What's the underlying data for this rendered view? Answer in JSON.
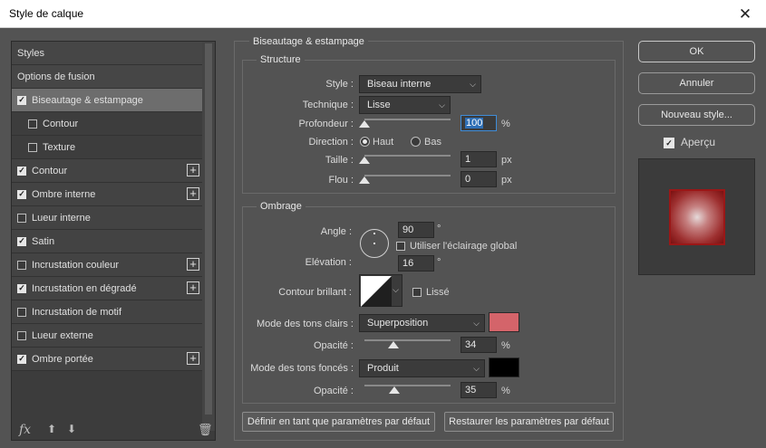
{
  "window": {
    "title": "Style de calque",
    "close_glyph": "✕"
  },
  "styles_list": [
    {
      "label": "Styles",
      "checkbox": false,
      "checked": false,
      "plus": false,
      "sub": false,
      "selected": false
    },
    {
      "label": "Options de fusion",
      "checkbox": false,
      "checked": false,
      "plus": false,
      "sub": false,
      "selected": false
    },
    {
      "label": "Biseautage & estampage",
      "checkbox": true,
      "checked": true,
      "plus": false,
      "sub": false,
      "selected": true
    },
    {
      "label": "Contour",
      "checkbox": true,
      "checked": false,
      "plus": false,
      "sub": true,
      "selected": false
    },
    {
      "label": "Texture",
      "checkbox": true,
      "checked": false,
      "plus": false,
      "sub": true,
      "selected": false
    },
    {
      "label": "Contour",
      "checkbox": true,
      "checked": true,
      "plus": true,
      "sub": false,
      "selected": false
    },
    {
      "label": "Ombre interne",
      "checkbox": true,
      "checked": true,
      "plus": true,
      "sub": false,
      "selected": false
    },
    {
      "label": "Lueur interne",
      "checkbox": true,
      "checked": false,
      "plus": false,
      "sub": false,
      "selected": false
    },
    {
      "label": "Satin",
      "checkbox": true,
      "checked": true,
      "plus": false,
      "sub": false,
      "selected": false
    },
    {
      "label": "Incrustation couleur",
      "checkbox": true,
      "checked": false,
      "plus": true,
      "sub": false,
      "selected": false
    },
    {
      "label": "Incrustation en dégradé",
      "checkbox": true,
      "checked": true,
      "plus": true,
      "sub": false,
      "selected": false
    },
    {
      "label": "Incrustation de motif",
      "checkbox": true,
      "checked": false,
      "plus": false,
      "sub": false,
      "selected": false
    },
    {
      "label": "Lueur externe",
      "checkbox": true,
      "checked": false,
      "plus": false,
      "sub": false,
      "selected": false
    },
    {
      "label": "Ombre portée",
      "checkbox": true,
      "checked": true,
      "plus": true,
      "sub": false,
      "selected": false
    }
  ],
  "fxbar": {
    "fx": "fx",
    "fx_dot": "⌄",
    "up": "⬆",
    "down": "⬇",
    "trash": "🗑"
  },
  "bevel": {
    "section_title": "Biseautage & estampage",
    "structure": {
      "title": "Structure",
      "style_label": "Style :",
      "style_value": "Biseau interne",
      "technique_label": "Technique :",
      "technique_value": "Lisse",
      "depth_label": "Profondeur :",
      "depth_value": "100",
      "depth_unit": "%",
      "depth_pct": 0,
      "direction_label": "Direction :",
      "dir_up": "Haut",
      "dir_down": "Bas",
      "direction_selected": "up",
      "size_label": "Taille :",
      "size_value": "1",
      "size_unit": "px",
      "size_pct": 0,
      "soften_label": "Flou :",
      "soften_value": "0",
      "soften_unit": "px",
      "soften_pct": 0
    },
    "shading": {
      "title": "Ombrage",
      "angle_label": "Angle :",
      "angle_value": "90",
      "angle_unit": "°",
      "global_light_label": "Utiliser l'éclairage global",
      "global_light": false,
      "altitude_label": "Elévation :",
      "altitude_value": "16",
      "altitude_unit": "°",
      "gloss_label": "Contour brillant :",
      "antialias_label": "Lissé",
      "antialias": false,
      "highlight_label": "Mode des tons clairs :",
      "highlight_mode": "Superposition",
      "highlight_color": "#d4646a",
      "highlight_opacity_label": "Opacité :",
      "highlight_opacity": "34",
      "highlight_opacity_unit": "%",
      "highlight_opacity_pct": 34,
      "shadow_label": "Mode des tons foncés :",
      "shadow_mode": "Produit",
      "shadow_color": "#000000",
      "shadow_opacity_label": "Opacité :",
      "shadow_opacity": "35",
      "shadow_opacity_unit": "%",
      "shadow_opacity_pct": 35
    },
    "make_default": "Définir en tant que paramètres par défaut",
    "reset_default": "Restaurer les paramètres par défaut"
  },
  "buttons": {
    "ok": "OK",
    "cancel": "Annuler",
    "new_style": "Nouveau style...",
    "preview_label": "Aperçu",
    "preview_checked": true
  }
}
